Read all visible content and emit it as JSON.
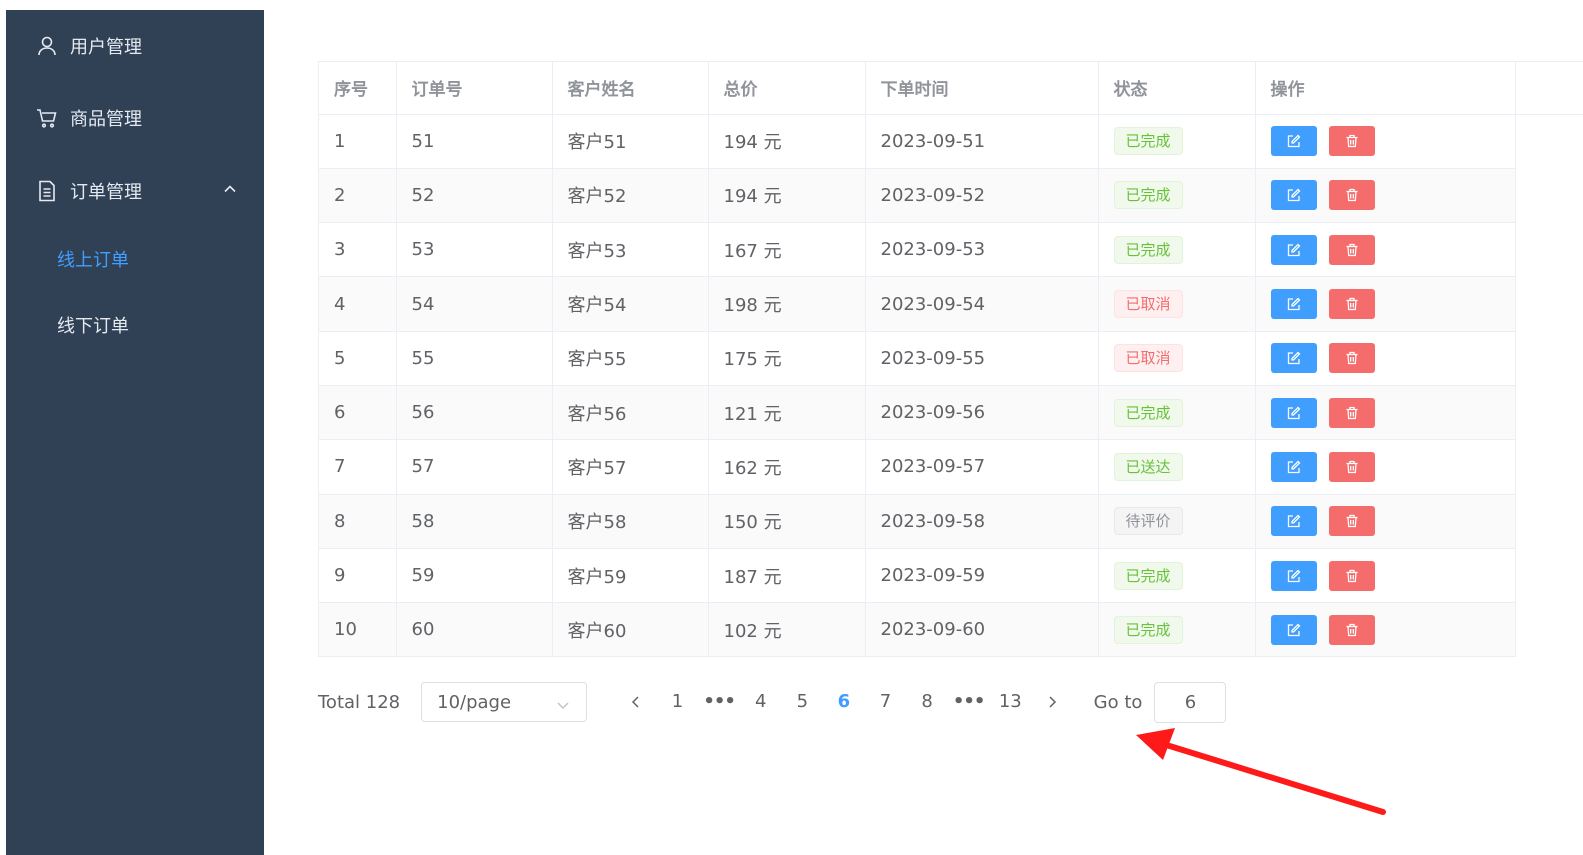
{
  "sidebar": {
    "items": [
      {
        "label": "用户管理",
        "icon": "user-icon"
      },
      {
        "label": "商品管理",
        "icon": "cart-icon"
      },
      {
        "label": "订单管理",
        "icon": "document-icon",
        "expanded": true
      }
    ],
    "subitems": [
      {
        "label": "线上订单",
        "active": true
      },
      {
        "label": "线下订单",
        "active": false
      }
    ]
  },
  "table": {
    "headers": [
      "序号",
      "订单号",
      "客户姓名",
      "总价",
      "下单时间",
      "状态",
      "操作"
    ],
    "rows": [
      {
        "index": "1",
        "order_no": "51",
        "customer": "客户51",
        "total": "194 元",
        "time": "2023-09-51",
        "status": "已完成",
        "status_type": "success"
      },
      {
        "index": "2",
        "order_no": "52",
        "customer": "客户52",
        "total": "194 元",
        "time": "2023-09-52",
        "status": "已完成",
        "status_type": "success"
      },
      {
        "index": "3",
        "order_no": "53",
        "customer": "客户53",
        "total": "167 元",
        "time": "2023-09-53",
        "status": "已完成",
        "status_type": "success"
      },
      {
        "index": "4",
        "order_no": "54",
        "customer": "客户54",
        "total": "198 元",
        "time": "2023-09-54",
        "status": "已取消",
        "status_type": "danger"
      },
      {
        "index": "5",
        "order_no": "55",
        "customer": "客户55",
        "total": "175 元",
        "time": "2023-09-55",
        "status": "已取消",
        "status_type": "danger"
      },
      {
        "index": "6",
        "order_no": "56",
        "customer": "客户56",
        "total": "121 元",
        "time": "2023-09-56",
        "status": "已完成",
        "status_type": "success"
      },
      {
        "index": "7",
        "order_no": "57",
        "customer": "客户57",
        "total": "162 元",
        "time": "2023-09-57",
        "status": "已送达",
        "status_type": "success"
      },
      {
        "index": "8",
        "order_no": "58",
        "customer": "客户58",
        "total": "150 元",
        "time": "2023-09-58",
        "status": "待评价",
        "status_type": "info"
      },
      {
        "index": "9",
        "order_no": "59",
        "customer": "客户59",
        "total": "187 元",
        "time": "2023-09-59",
        "status": "已完成",
        "status_type": "success"
      },
      {
        "index": "10",
        "order_no": "60",
        "customer": "客户60",
        "total": "102 元",
        "time": "2023-09-60",
        "status": "已完成",
        "status_type": "success"
      }
    ]
  },
  "pagination": {
    "total_label": "Total 128",
    "page_size": "10/page",
    "pages": [
      "1",
      "•••",
      "4",
      "5",
      "6",
      "7",
      "8",
      "•••",
      "13"
    ],
    "current": "6",
    "goto_label": "Go to",
    "goto_value": "6"
  },
  "colors": {
    "sidebar_bg": "#304156",
    "accent": "#409eff",
    "danger": "#f56c6c",
    "success": "#67c23a",
    "annotation_arrow": "#ff1a1a"
  }
}
